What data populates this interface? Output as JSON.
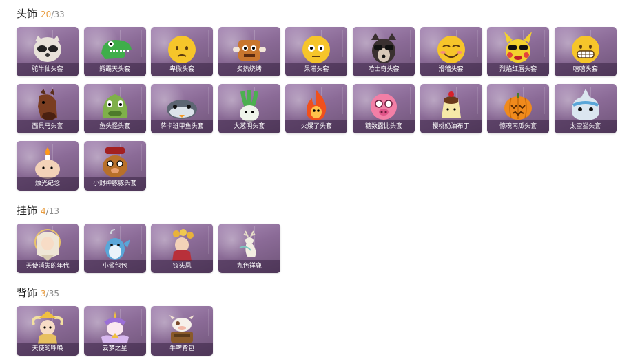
{
  "sections": {
    "head": {
      "title": "头饰",
      "owned": "20",
      "slash": "/",
      "total": "33",
      "items": [
        {
          "label": "驼半仙头套",
          "icon": "raccoon-icon"
        },
        {
          "label": "鳄霸天头套",
          "icon": "crocodile-icon"
        },
        {
          "label": "卑微头套",
          "icon": "shy-emoji-icon"
        },
        {
          "label": "炙热烧烤",
          "icon": "grilled-meat-icon"
        },
        {
          "label": "呆滞头套",
          "icon": "dazed-emoji-icon"
        },
        {
          "label": "哈士奇头套",
          "icon": "husky-icon"
        },
        {
          "label": "滑稽头套",
          "icon": "funny-emoji-icon"
        },
        {
          "label": "烈焰红唇头套",
          "icon": "pikachu-sunglasses-icon"
        },
        {
          "label": "嘻嘻头套",
          "icon": "grin-emoji-icon"
        },
        {
          "label": "面具马头套",
          "icon": "horse-icon"
        },
        {
          "label": "鱼头怪头套",
          "icon": "fish-head-icon"
        },
        {
          "label": "萨卡班甲鱼头套",
          "icon": "fish-icon"
        },
        {
          "label": "大葱明头套",
          "icon": "green-onion-icon"
        },
        {
          "label": "火爆了头套",
          "icon": "fire-icon"
        },
        {
          "label": "糖数露比头套",
          "icon": "pink-pig-icon"
        },
        {
          "label": "樱桃奶油布丁",
          "icon": "pudding-icon"
        },
        {
          "label": "惊魂南瓜头套",
          "icon": "pumpkin-icon"
        },
        {
          "label": "太空鲨头套",
          "icon": "shark-icon"
        },
        {
          "label": "烛光纪念",
          "icon": "candle-icon"
        },
        {
          "label": "小财神豚豚头套",
          "icon": "piggy-god-icon"
        }
      ]
    },
    "hanging": {
      "title": "挂饰",
      "owned": "4",
      "slash": "/",
      "total": "13",
      "items": [
        {
          "label": "天使消失的年代",
          "icon": "angel-girl-icon"
        },
        {
          "label": "小鲨包包",
          "icon": "shark-bag-icon"
        },
        {
          "label": "钗头凤",
          "icon": "phoenix-hairpin-icon"
        },
        {
          "label": "九色祥鹿",
          "icon": "deer-icon"
        }
      ]
    },
    "back": {
      "title": "背饰",
      "owned": "3",
      "slash": "/",
      "total": "35",
      "items": [
        {
          "label": "天使的呼唤",
          "icon": "angel-child-icon"
        },
        {
          "label": "云梦之星",
          "icon": "unicorn-icon"
        },
        {
          "label": "牛啤背包",
          "icon": "cow-backpack-icon"
        }
      ]
    }
  },
  "colors": {
    "accent_count": "#e89a3c",
    "card_bg": "#8b6b97"
  }
}
